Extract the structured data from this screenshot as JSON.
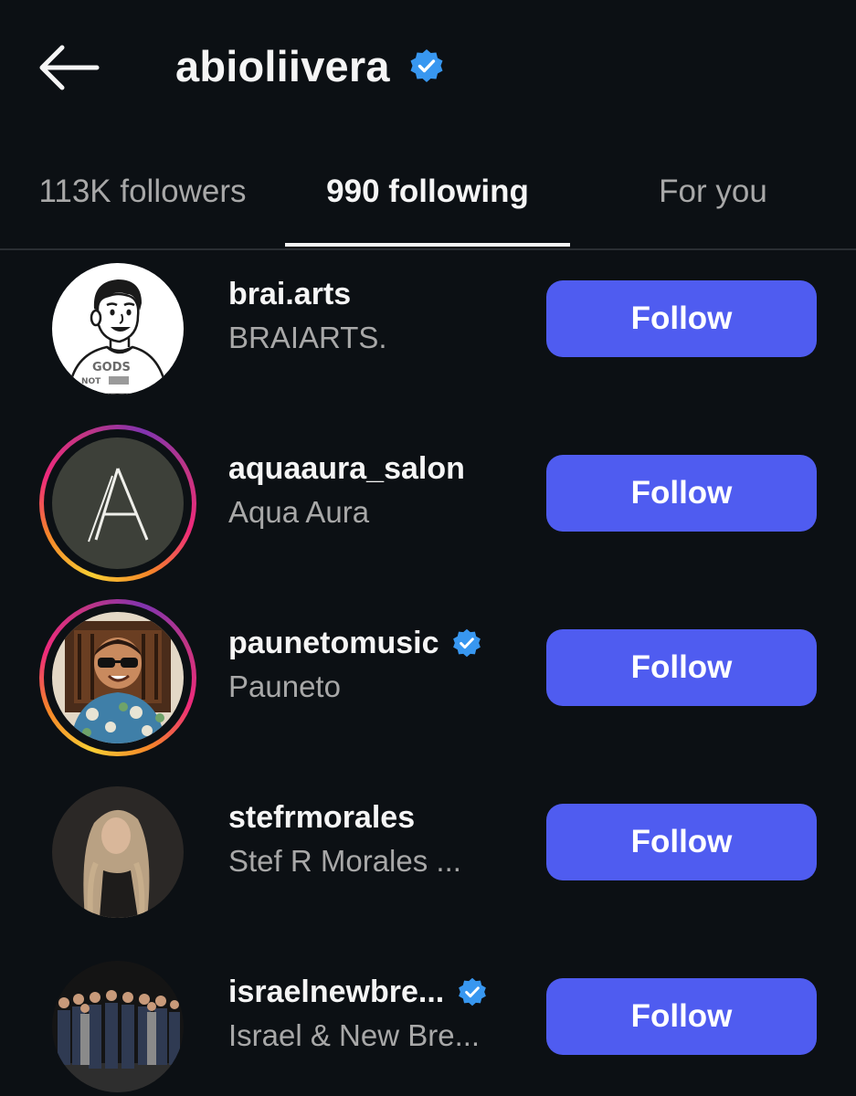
{
  "header": {
    "title": "abioliivera",
    "verified": true
  },
  "tabs": [
    {
      "label": "113K followers",
      "active": false
    },
    {
      "label": "990 following",
      "active": true
    },
    {
      "label": "For you",
      "active": false
    }
  ],
  "users": [
    {
      "username": "brai.arts",
      "full_name": "BRAIARTS.",
      "verified": false,
      "story_ring": false,
      "follow_label": "Follow"
    },
    {
      "username": "aquaaura_salon",
      "full_name": "Aqua Aura",
      "verified": false,
      "story_ring": true,
      "follow_label": "Follow"
    },
    {
      "username": "paunetomusic",
      "full_name": "Pauneto",
      "verified": true,
      "story_ring": true,
      "follow_label": "Follow"
    },
    {
      "username": "stefrmorales",
      "full_name": "Stef R Morales ...",
      "verified": false,
      "story_ring": false,
      "follow_label": "Follow"
    },
    {
      "username": "israelnewbre...",
      "full_name": "Israel & New Bre...",
      "verified": true,
      "story_ring": false,
      "follow_label": "Follow"
    }
  ],
  "avatar_text": {
    "brai_shirt_line1": "GODS",
    "brai_shirt_line2": "NOT"
  },
  "colors": {
    "background": "#0c1014",
    "primary_text": "#f5f5f5",
    "secondary_text": "#a8a8a8",
    "follow_button": "#4f5cf0",
    "verified_badge": "#3897f0",
    "divider": "#2a2e33"
  },
  "icons": {
    "back": "arrow-left-icon",
    "verified": "verified-badge-icon"
  }
}
